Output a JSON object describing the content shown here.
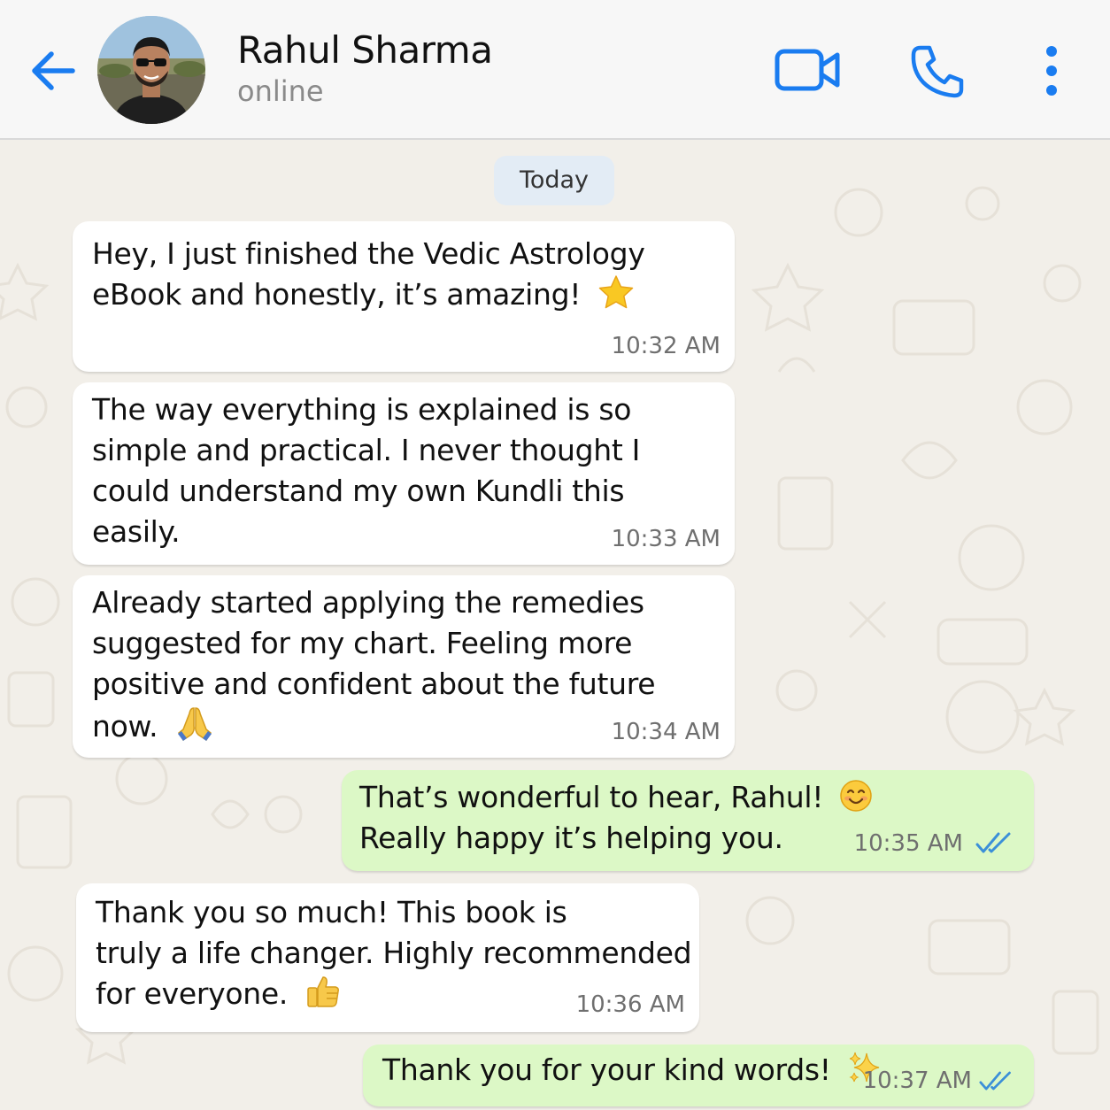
{
  "header": {
    "contact_name": "Rahul Sharma",
    "status": "online",
    "accent_color": "#1a7cf0"
  },
  "icons": {
    "back": "arrow-left-icon",
    "video": "video-camera-icon",
    "call": "phone-icon",
    "menu": "more-vertical-icon"
  },
  "chat": {
    "date_label": "Today",
    "messages": [
      {
        "direction": "incoming",
        "lines": [
          "Hey, I just finished the Vedic Astrology",
          "eBook and honestly, it’s amazing!"
        ],
        "emoji": "star",
        "time": "10:32 AM"
      },
      {
        "direction": "incoming",
        "lines": [
          "The way everything is explained is so",
          "simple and practical. I never thought I",
          "could understand my own Kundli this",
          "easily."
        ],
        "time": "10:33 AM"
      },
      {
        "direction": "incoming",
        "lines": [
          "Already started applying the remedies",
          "suggested for my chart. Feeling more",
          "positive and confident about the future",
          "now."
        ],
        "emoji": "folded-hands",
        "time": "10:34 AM"
      },
      {
        "direction": "outgoing",
        "lines": [
          "That’s wonderful to hear, Rahul!",
          "Really happy it’s helping you."
        ],
        "emoji": "smiling-face",
        "time": "10:35 AM",
        "status": "read"
      },
      {
        "direction": "incoming",
        "lines": [
          "Thank you so much! This book is",
          "truly a life changer. Highly recommended",
          "for everyone."
        ],
        "emoji": "thumbs-up",
        "time": "10:36 AM"
      },
      {
        "direction": "outgoing",
        "lines": [
          "Thank you for your kind words!"
        ],
        "emoji": "sparkles",
        "time": "10:37 AM",
        "status": "read"
      }
    ]
  },
  "colors": {
    "incoming_bubble": "#ffffff",
    "outgoing_bubble": "#dcf8c6",
    "read_ticks": "#3b8fd8",
    "date_pill": "#e3ecf5"
  }
}
